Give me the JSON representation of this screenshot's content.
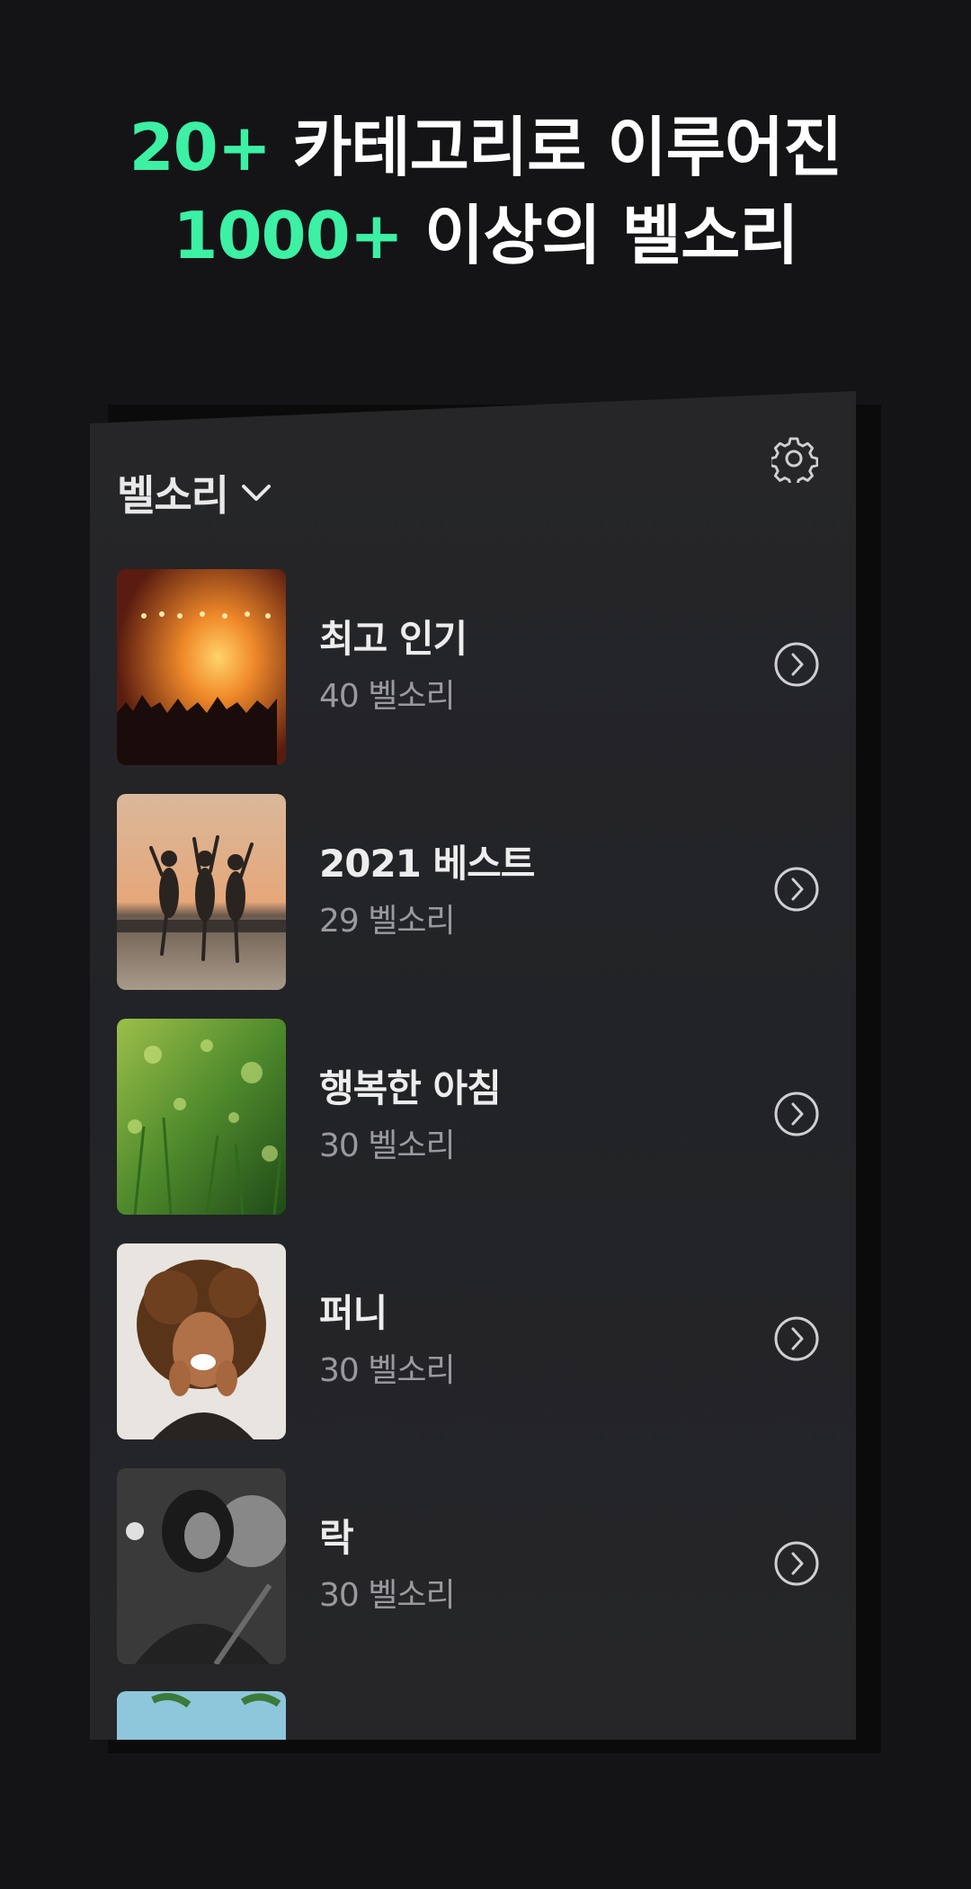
{
  "headline": {
    "line1_accent": "20+",
    "line1_rest": "카테고리로 이루어진",
    "line2_accent": "1000+",
    "line2_rest": "이상의 벨소리"
  },
  "colors": {
    "accent": "#3cf0a4",
    "background": "#141416",
    "panel": "#242528"
  },
  "header": {
    "title": "벨소리",
    "dropdown_icon": "chevron-down-icon",
    "settings_icon": "gear-icon"
  },
  "categories": [
    {
      "title": "최고 인기",
      "count": "40 벨소리",
      "thumb": "concert-crowd"
    },
    {
      "title": "2021 베스트",
      "count": "29 벨소리",
      "thumb": "beach-jumping"
    },
    {
      "title": "행복한 아침",
      "count": "30 벨소리",
      "thumb": "morning-grass"
    },
    {
      "title": "퍼니",
      "count": "30 벨소리",
      "thumb": "laughing-woman"
    },
    {
      "title": "락",
      "count": "30 벨소리",
      "thumb": "rock-guitarist"
    },
    {
      "title": "",
      "count": "",
      "thumb": "palm-sky"
    }
  ]
}
